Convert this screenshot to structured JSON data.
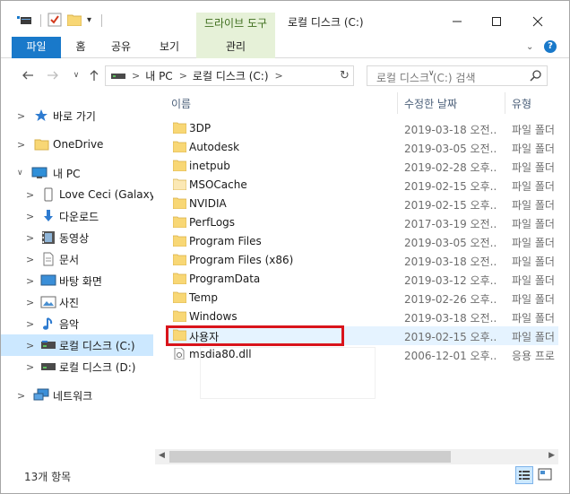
{
  "titlebar": {
    "context_tab_head": "드라이브 도구",
    "window_title": "로컬 디스크 (C:)"
  },
  "ribbon": {
    "tabs": [
      {
        "label": "파일"
      },
      {
        "label": "홈"
      },
      {
        "label": "공유"
      },
      {
        "label": "보기"
      },
      {
        "label": "관리"
      }
    ]
  },
  "address": {
    "crumbs": [
      "내 PC",
      "로컬 디스크 (C:)"
    ]
  },
  "search": {
    "placeholder": "로컬 디스크 (C:) 검색"
  },
  "navpane": {
    "items": [
      {
        "label": "바로 가기",
        "icon": "star-icon"
      },
      {
        "label": "OneDrive",
        "icon": "folder-icon"
      },
      {
        "label": "내 PC",
        "icon": "pc-icon"
      },
      {
        "label": "Love Ceci (Galaxy S",
        "icon": "device-icon"
      },
      {
        "label": "다운로드",
        "icon": "download-icon"
      },
      {
        "label": "동영상",
        "icon": "video-icon"
      },
      {
        "label": "문서",
        "icon": "document-icon"
      },
      {
        "label": "바탕 화면",
        "icon": "desktop-icon"
      },
      {
        "label": "사진",
        "icon": "pictures-icon"
      },
      {
        "label": "음악",
        "icon": "music-icon"
      },
      {
        "label": "로컬 디스크 (C:)",
        "icon": "drive-icon",
        "selected": true
      },
      {
        "label": "로컬 디스크 (D:)",
        "icon": "drive-icon"
      },
      {
        "label": "네트워크",
        "icon": "network-icon"
      }
    ]
  },
  "columns": {
    "name": "이름",
    "date": "수정한 날짜",
    "type": "유형"
  },
  "files": [
    {
      "name": "3DP",
      "date": "2019-03-18 오전...",
      "type": "파일 폴더"
    },
    {
      "name": "Autodesk",
      "date": "2019-03-05 오전...",
      "type": "파일 폴더"
    },
    {
      "name": "inetpub",
      "date": "2019-02-28 오후...",
      "type": "파일 폴더"
    },
    {
      "name": "MSOCache",
      "date": "2019-02-15 오후...",
      "type": "파일 폴더"
    },
    {
      "name": "NVIDIA",
      "date": "2019-02-15 오후...",
      "type": "파일 폴더"
    },
    {
      "name": "PerfLogs",
      "date": "2017-03-19 오전...",
      "type": "파일 폴더"
    },
    {
      "name": "Program Files",
      "date": "2019-03-05 오전...",
      "type": "파일 폴더"
    },
    {
      "name": "Program Files (x86)",
      "date": "2019-03-18 오전...",
      "type": "파일 폴더"
    },
    {
      "name": "ProgramData",
      "date": "2019-03-12 오후...",
      "type": "파일 폴더"
    },
    {
      "name": "Temp",
      "date": "2019-02-26 오후...",
      "type": "파일 폴더"
    },
    {
      "name": "Windows",
      "date": "2019-03-18 오전...",
      "type": "파일 폴더"
    },
    {
      "name": "사용자",
      "date": "2019-02-15 오후...",
      "type": "파일 폴더"
    },
    {
      "name": "msdia80.dll",
      "date": "2006-12-01 오후...",
      "type": "응용 프로"
    }
  ],
  "status": {
    "item_count": "13개 항목"
  },
  "colors": {
    "accent": "#1979ca",
    "selection": "#cce8ff",
    "hover": "#e5f3ff",
    "annotation": "#d9141b",
    "folder": "#f8d775"
  }
}
